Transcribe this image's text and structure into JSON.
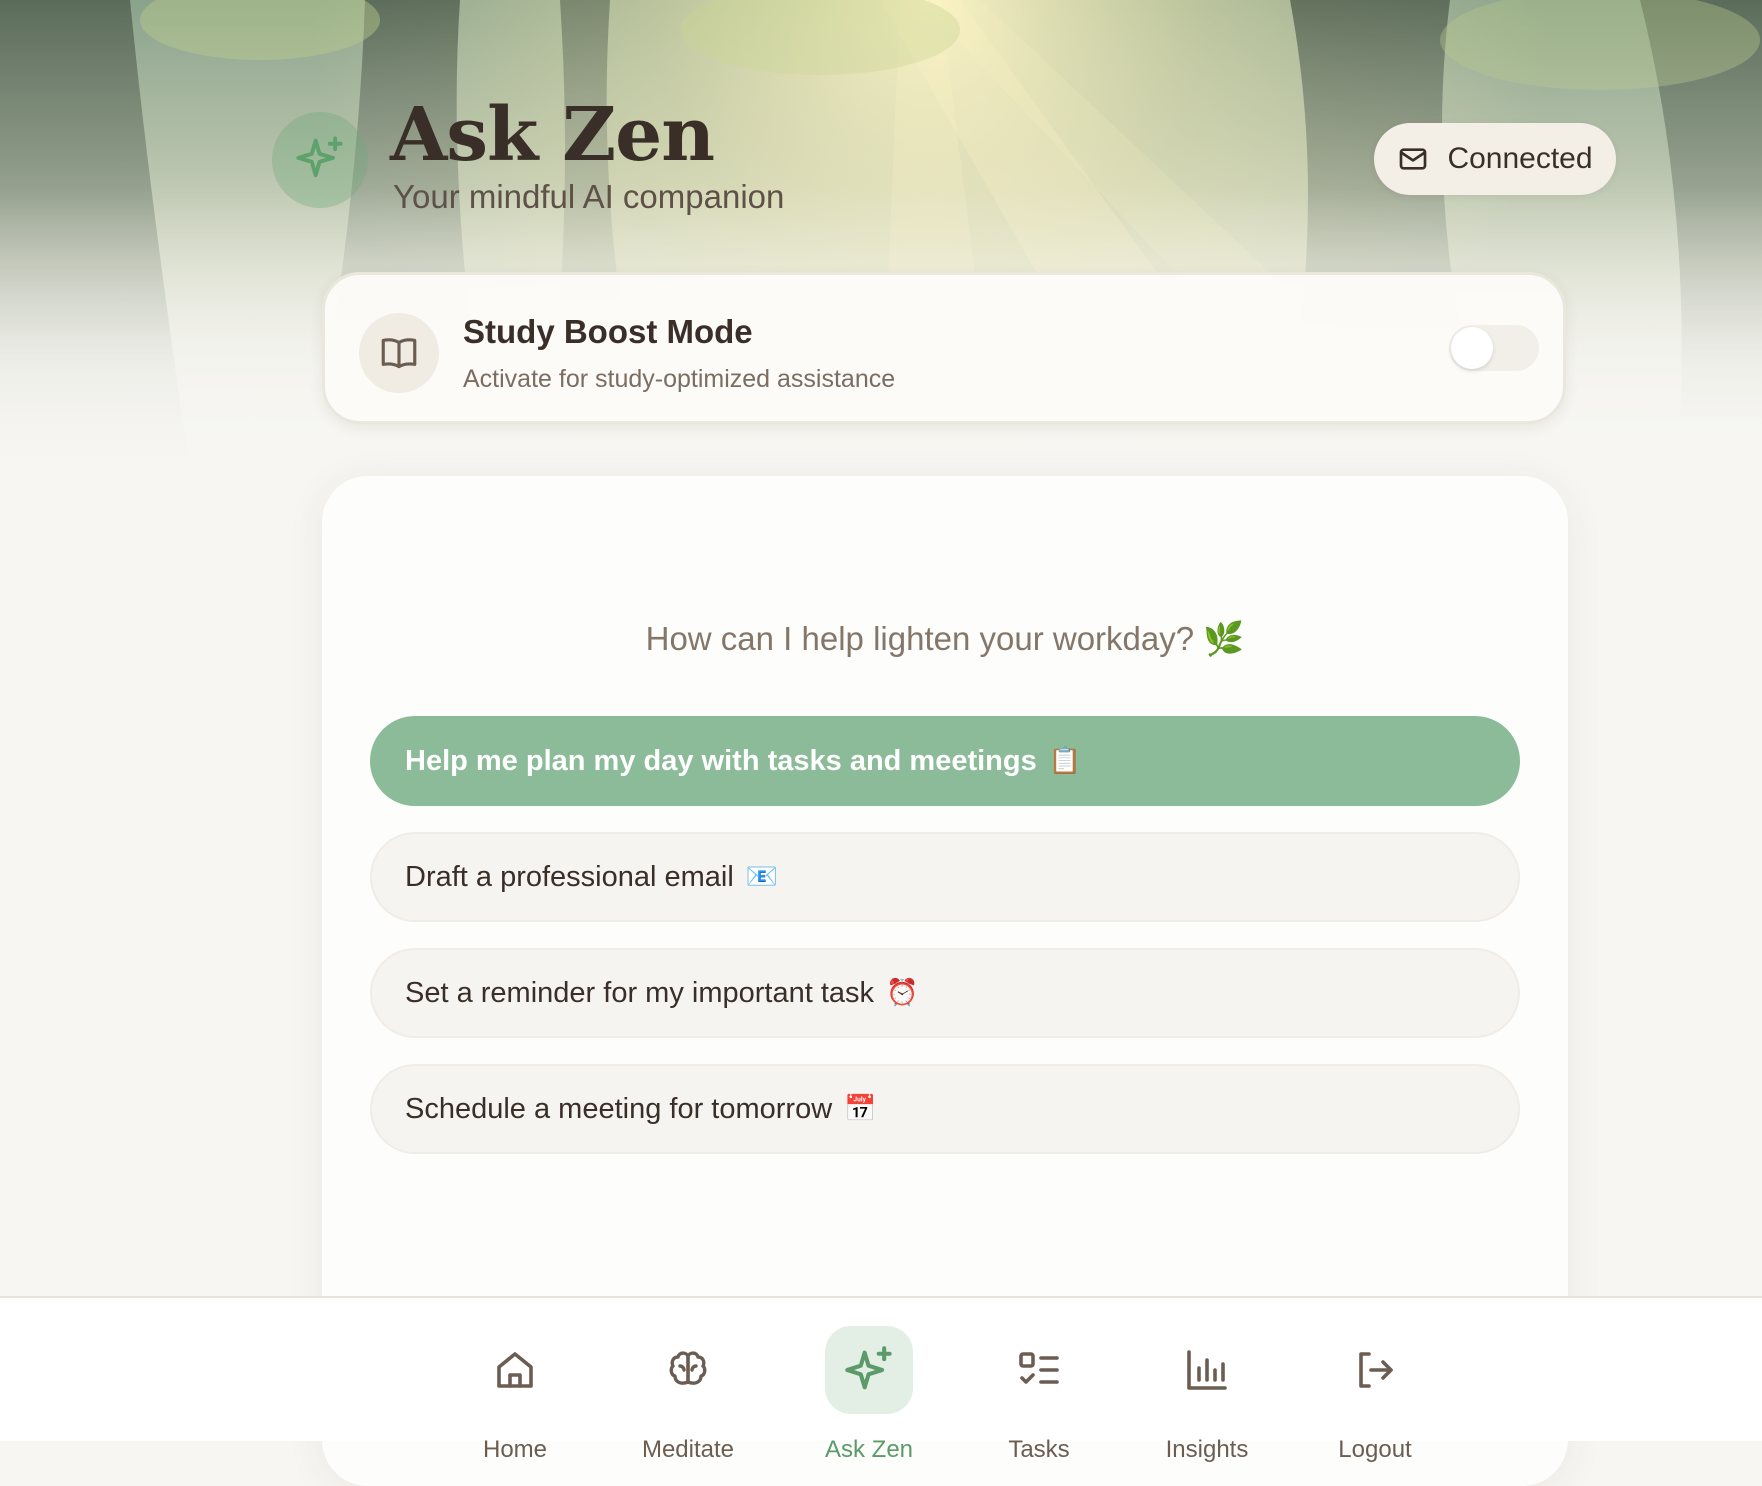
{
  "header": {
    "title": "Ask Zen",
    "subtitle": "Your mindful AI companion",
    "logo_icon": "sparkles-icon",
    "connection_status": "Connected",
    "connection_icon": "mail-icon"
  },
  "study_mode": {
    "title": "Study Boost Mode",
    "description": "Activate for study-optimized assistance",
    "icon": "open-book-icon",
    "enabled": false
  },
  "chat": {
    "prompt": "How can I help lighten your workday? 🌿",
    "suggestions": [
      {
        "text": "Help me plan my day with tasks and meetings",
        "emoji": "📋",
        "active": true
      },
      {
        "text": "Draft a professional email",
        "emoji": "📧",
        "active": false
      },
      {
        "text": "Set a reminder for my important task",
        "emoji": "⏰",
        "active": false
      },
      {
        "text": "Schedule a meeting for tomorrow",
        "emoji": "📅",
        "active": false
      }
    ]
  },
  "nav": {
    "items": [
      {
        "label": "Home",
        "icon": "home-icon",
        "active": false
      },
      {
        "label": "Meditate",
        "icon": "brain-icon",
        "active": false
      },
      {
        "label": "Ask Zen",
        "icon": "sparkles-icon",
        "active": true
      },
      {
        "label": "Tasks",
        "icon": "tasks-list-icon",
        "active": false
      },
      {
        "label": "Insights",
        "icon": "bar-chart-icon",
        "active": false
      },
      {
        "label": "Logout",
        "icon": "logout-icon",
        "active": false
      }
    ]
  },
  "colors": {
    "accent_green": "#8bbb98",
    "active_nav_green": "#5c9a6a",
    "text_dark": "#3a2f28",
    "background": "#f7f6f2"
  }
}
